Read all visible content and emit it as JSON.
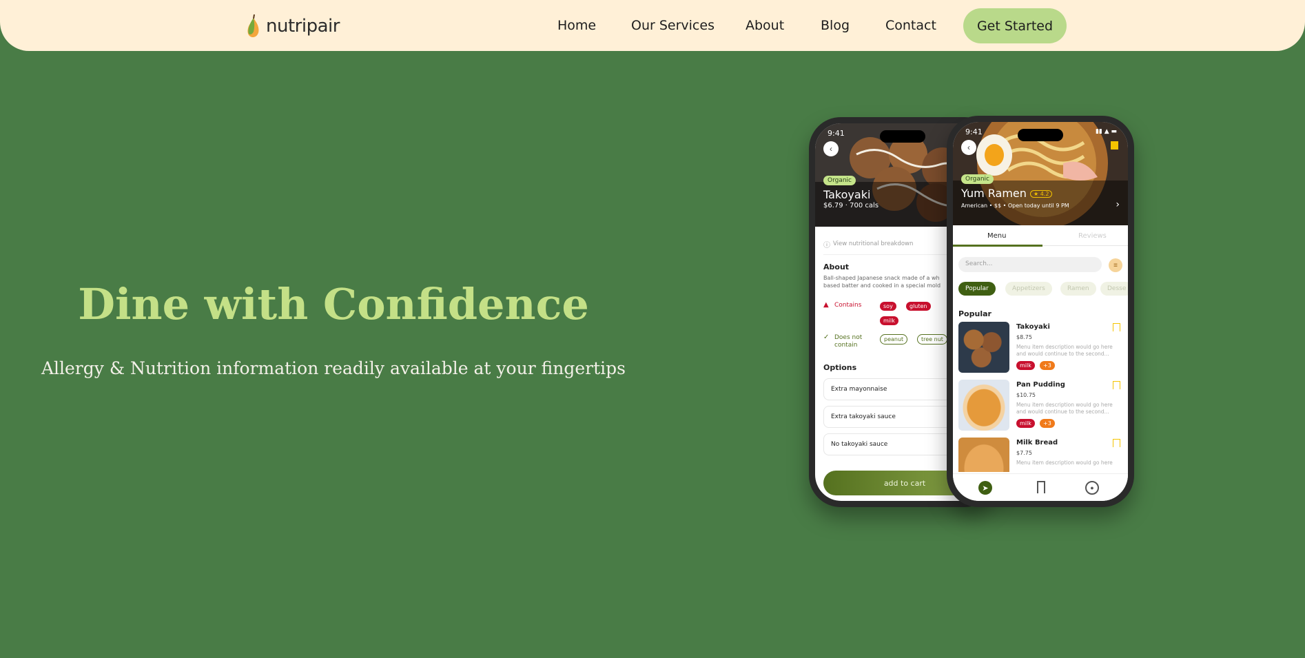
{
  "nav": {
    "brand": "nutripair",
    "links": [
      "Home",
      "Our Services",
      "About",
      "Blog",
      "Contact"
    ],
    "cta": "Get Started"
  },
  "hero": {
    "title": "Dine with Confidence",
    "subtitle": "Allergy & Nutrition information readily available at your fingertips"
  },
  "phone_back": {
    "time": "9:41",
    "badge": "Organic",
    "dish": "Takoyaki",
    "meta": "$6.79 · 700 cals",
    "nutrition_link": "View nutritional breakdown",
    "about_heading": "About",
    "about_text_1": "Ball-shaped Japanese snack made of a wh",
    "about_text_2": "based batter and cooked in a special mold",
    "contains_label": "Contains",
    "contains": [
      "soy",
      "gluten",
      "milk"
    ],
    "not_contain_label_1": "Does not",
    "not_contain_label_2": "contain",
    "not_contains": [
      "peanut",
      "tree nut"
    ],
    "options_heading": "Options",
    "options": [
      "Extra mayonnaise",
      "Extra takoyaki sauce",
      "No takoyaki sauce"
    ],
    "cart": "add to cart"
  },
  "phone_front": {
    "time": "9:41",
    "badge": "Organic",
    "restaurant": "Yum Ramen",
    "rating": "4.2",
    "meta": "American • $$ • Open today until 9 PM",
    "tabs": [
      "Menu",
      "Reviews"
    ],
    "search_placeholder": "Search...",
    "filters": [
      "Popular",
      "Appetizers",
      "Ramen",
      "Desse"
    ],
    "section": "Popular",
    "items": [
      {
        "name": "Takoyaki",
        "price": "$8.75",
        "desc_1": "Menu item description would go here",
        "desc_2": "and would continue to the second...",
        "tag": "milk",
        "more": "+3"
      },
      {
        "name": "Pan Pudding",
        "price": "$10.75",
        "desc_1": "Menu item description would go here",
        "desc_2": "and would continue to the second...",
        "tag": "milk",
        "more": "+3"
      },
      {
        "name": "Milk Bread",
        "price": "$7.75",
        "desc_1": "Menu item description would go here",
        "desc_2": "",
        "tag": "",
        "more": ""
      }
    ]
  },
  "colors": {
    "background": "#497c46",
    "nav": "#fff0d7",
    "accent": "#b9d98a",
    "title": "#c4e087",
    "allergen_red": "#c8102e",
    "olive": "#55711f"
  },
  "icons": [
    "pear-logo-icon",
    "back-chevron-icon",
    "leaf-icon",
    "warning-icon",
    "check-icon",
    "bookmark-icon",
    "compass-icon",
    "profile-icon",
    "filter-icon",
    "info-icon"
  ]
}
